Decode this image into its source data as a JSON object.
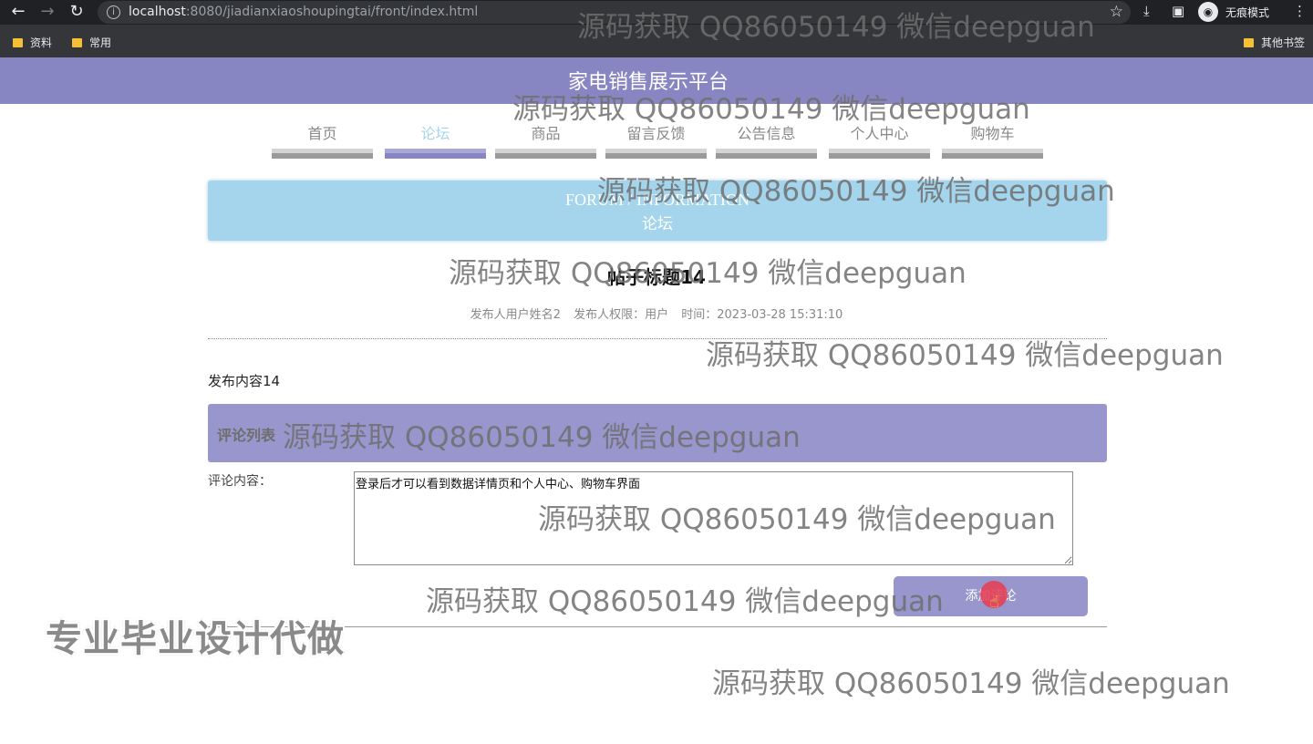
{
  "browser": {
    "url_host": "localhost",
    "url_rest": ":8080/jiadianxiaoshoupingtai/front/index.html",
    "incognito_label": "无痕模式",
    "bookmarks": [
      "资料",
      "常用"
    ],
    "other_bookmarks": "其他书签"
  },
  "site": {
    "title": "家电销售展示平台",
    "nav": [
      "首页",
      "论坛",
      "商品",
      "留言反馈",
      "公告信息",
      "个人中心",
      "购物车"
    ],
    "active_nav": "论坛"
  },
  "banner": {
    "en": "FORUM / INFORMATION",
    "cn": "论坛"
  },
  "post": {
    "title": "帖子标题14",
    "author": "发布人用户姓名2",
    "role": "发布人权限：用户",
    "time": "时间：2023-03-28 15:31:10",
    "content": "发布内容14"
  },
  "comments": {
    "header": "评论列表",
    "label": "评论内容：",
    "textarea_value": "登录后才可以看到数据详情页和个人中心、购物车界面",
    "add_button": "添加评论"
  },
  "overlay": {
    "watermark": "源码获取 QQ86050149 微信deepguan",
    "promo": "专业毕业设计代做"
  },
  "colors": {
    "primary": "#8886c2",
    "banner": "#a4d5ec",
    "chrome_dark": "#202124"
  }
}
